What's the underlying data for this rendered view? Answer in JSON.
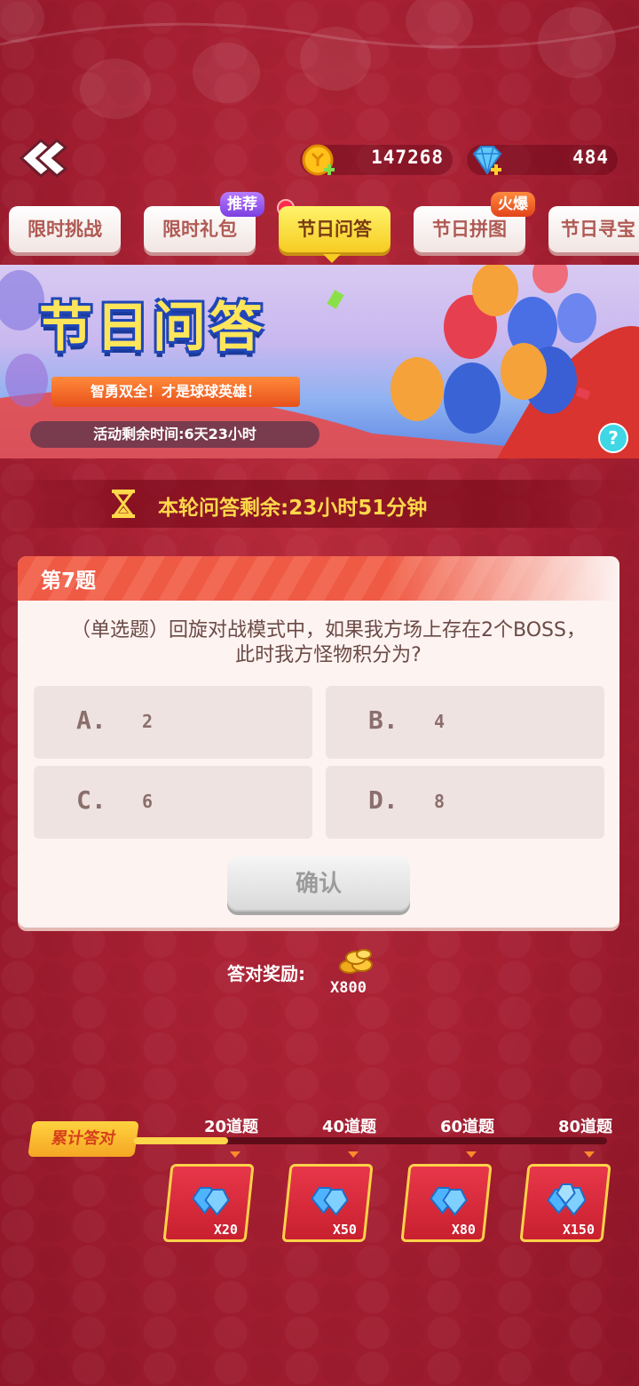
{
  "currencies": {
    "coins": "147268",
    "gems": "484"
  },
  "tabs": [
    {
      "label": "限时挑战"
    },
    {
      "label": "限时礼包",
      "badge": "推荐"
    },
    {
      "label": "节日问答",
      "active": true
    },
    {
      "label": "节日拼图",
      "badge": "火爆"
    },
    {
      "label": "节日寻宝"
    }
  ],
  "banner": {
    "title": "节日问答",
    "slogan": "智勇双全！才是球球英雄！",
    "remaining": "活动剩余时间:6天23小时",
    "help": "?"
  },
  "round_countdown": "本轮问答剩余:23小时51分钟",
  "question": {
    "number": "第7题",
    "text": "（单选题）回旋对战模式中，如果我方场上存在2个BOSS，此时我方怪物积分为?",
    "options": [
      {
        "label": "A.",
        "value": "2"
      },
      {
        "label": "B.",
        "value": "4"
      },
      {
        "label": "C.",
        "value": "6"
      },
      {
        "label": "D.",
        "value": "8"
      }
    ],
    "confirm": "确认"
  },
  "reward": {
    "label": "答对奖励:",
    "qty": "X800"
  },
  "cumulative": {
    "label": "累计答对",
    "progress": 0.2,
    "milestones": [
      {
        "label": "20道题",
        "qty": "X20"
      },
      {
        "label": "40道题",
        "qty": "X50"
      },
      {
        "label": "60道题",
        "qty": "X80"
      },
      {
        "label": "80道题",
        "qty": "X150"
      }
    ]
  },
  "colors": {
    "accent": "#f6cc22",
    "card_header": "#ef5a45",
    "background": "#a51f32"
  },
  "icons": [
    "back-arrow-icon",
    "coin-icon",
    "gem-icon",
    "hourglass-icon",
    "gold-coins-icon",
    "diamond-icon"
  ]
}
